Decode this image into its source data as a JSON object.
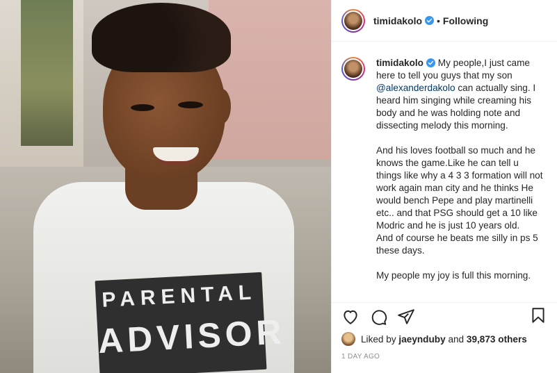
{
  "post": {
    "username": "timidakolo",
    "follow_separator": "•",
    "follow_status": "Following",
    "photo_shirt_text_top": "PARENTAL",
    "photo_shirt_text_bottom": "ADVISOR",
    "caption": {
      "p1_before": "My people,I just came here to tell you guys that my son ",
      "mention": "@alexanderdakolo",
      "p1_after": " can actually sing. I heard him singing while creaming his body and he was holding note and dissecting melody this morning.",
      "p2": "And his loves football so much and he knows the game.Like he can tell u things like why a 4 3 3 formation will not work again man city and he thinks He would bench Pepe and play martinelli etc.. and that PSG should get a 10 like Modric and he is just 10 years old.",
      "p3": "And of course he beats me silly in ps 5 these days.",
      "p4": "My people my joy is full this morning."
    },
    "likes": {
      "prefix": "Liked by",
      "user": "jaeynduby",
      "and": "and",
      "count": "39,873 others"
    },
    "timestamp": "1 DAY AGO"
  },
  "icons": {
    "verified": "verified-badge-icon",
    "like": "heart-icon",
    "comment": "comment-icon",
    "share": "share-icon",
    "save": "bookmark-icon"
  },
  "colors": {
    "verified_blue": "#3897f0",
    "mention_blue": "#00376b",
    "muted": "#8e8e8e"
  }
}
